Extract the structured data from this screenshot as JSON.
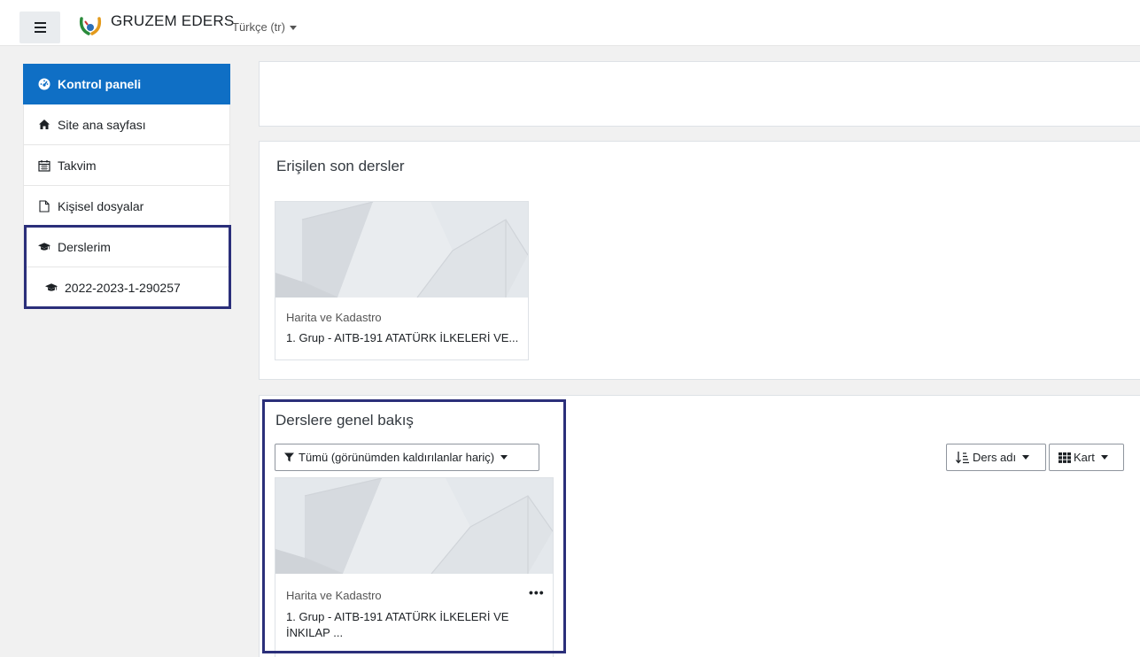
{
  "header": {
    "brand": "GRUZEM EDERS",
    "language": "Türkçe (tr)"
  },
  "sidebar": {
    "items": [
      {
        "label": "Kontrol paneli",
        "icon": "dashboard-icon"
      },
      {
        "label": "Site ana sayfası",
        "icon": "home-icon"
      },
      {
        "label": "Takvim",
        "icon": "calendar-icon"
      },
      {
        "label": "Kişisel dosyalar",
        "icon": "file-icon"
      },
      {
        "label": "Derslerim",
        "icon": "graduation-cap-icon"
      },
      {
        "label": "2022-2023-1-290257",
        "icon": "graduation-cap-icon"
      }
    ]
  },
  "recent": {
    "title": "Erişilen son dersler",
    "course": {
      "category": "Harita ve Kadastro",
      "name": "1. Grup - AITB-191 ATATÜRK İLKELERİ VE..."
    }
  },
  "overview": {
    "title": "Derslere genel bakış",
    "filter_label": "Tümü (görünümden kaldırılanlar hariç)",
    "sort_label": "Ders adı",
    "view_label": "Kart",
    "course": {
      "category": "Harita ve Kadastro",
      "name": "1. Grup - AITB-191 ATATÜRK İLKELERİ VE İNKILAP ...",
      "menu": "•••"
    }
  },
  "colors": {
    "accent": "#0f6fc5",
    "highlight": "#2b2f7a"
  }
}
